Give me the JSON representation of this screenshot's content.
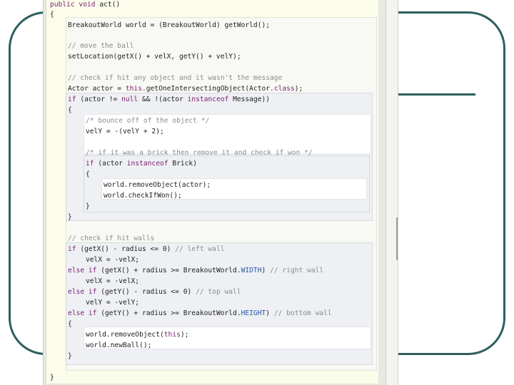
{
  "colors": {
    "frame": "#2f5e5e",
    "page_background": "#fbfcea",
    "keyword": "#7a1f6e",
    "comment": "#8c8c8c",
    "field": "#2a57a8"
  },
  "code": {
    "l01": "public void act()",
    "l02": "{",
    "l03": "BreakoutWorld world = (BreakoutWorld) getWorld();",
    "l04": "// move the ball",
    "l05": "setLocation(getX() + velX, getY() + velY);",
    "l06": "// check if hit any object and it wasn't the message",
    "l07": "Actor actor = this.getOneIntersectingObject(Actor.class);",
    "l08": "if (actor != null && !(actor instanceof Message))",
    "l09": "{",
    "l10": "/* bounce off of the object */",
    "l11": "velY = -(velY + 2);",
    "l12": "/* if it was a brick then remove it and check if won */",
    "l13": "if (actor instanceof Brick)",
    "l14": "{",
    "l15": "world.removeObject(actor);",
    "l16": "world.checkIfWon();",
    "l17": "}",
    "l18": "}",
    "l19": "// check if hit walls",
    "l20": "if (getX() - radius <= 0) // left wall",
    "l21": "velX = -velX;",
    "l22": "else if (getX() + radius >= BreakoutWorld.WIDTH) // right wall",
    "l23": "velX = -velX;",
    "l24": "else if (getY() - radius <= 0) // top wall",
    "l25": "velY = -velY;",
    "l26": "else if (getY() + radius >= BreakoutWorld.HEIGHT) // bottom wall",
    "l27": "{",
    "l28": "world.removeObject(this);",
    "l29": "world.newBall();",
    "l30": "}",
    "l31": "}"
  }
}
